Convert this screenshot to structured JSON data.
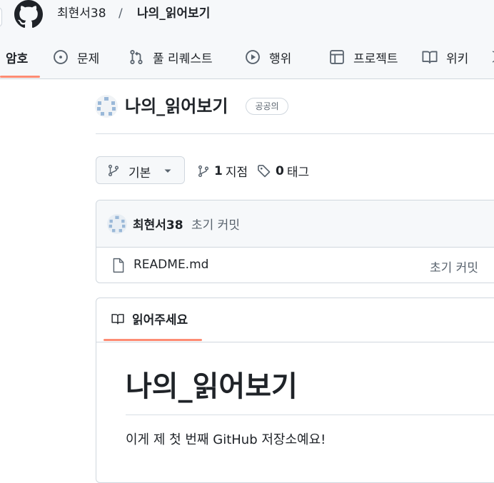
{
  "header": {
    "owner": "최현서38",
    "separator": "/",
    "repo_name": "나의_읽어보기"
  },
  "tabs": [
    {
      "label": "암호",
      "icon": "code-icon",
      "active": true
    },
    {
      "label": "문제",
      "icon": "issue-icon",
      "active": false
    },
    {
      "label": "풀 리퀘스트",
      "icon": "pull-request-icon",
      "active": false
    },
    {
      "label": "행위",
      "icon": "play-icon",
      "active": false
    },
    {
      "label": "프로젝트",
      "icon": "table-icon",
      "active": false
    },
    {
      "label": "위키",
      "icon": "book-icon",
      "active": false
    }
  ],
  "repo": {
    "title": "나의_읽어보기",
    "visibility": "공공의"
  },
  "branch": {
    "current": "기본",
    "branch_count": "1",
    "branch_label": "지점",
    "tag_count": "0",
    "tag_label": "태그"
  },
  "commit": {
    "author": "최현서38",
    "message": "초기 커밋"
  },
  "files": [
    {
      "name": "README.md",
      "commit_message": "초기 커밋"
    }
  ],
  "readme": {
    "tab_label": "읽어주세요",
    "heading": "나의_읽어보기",
    "body": "이게 제 첫 번째 GitHub 저장소예요!"
  },
  "colors": {
    "accent_underline": "#fd8c73",
    "header_bg": "#f6f8fa",
    "border": "#d0d7de"
  }
}
